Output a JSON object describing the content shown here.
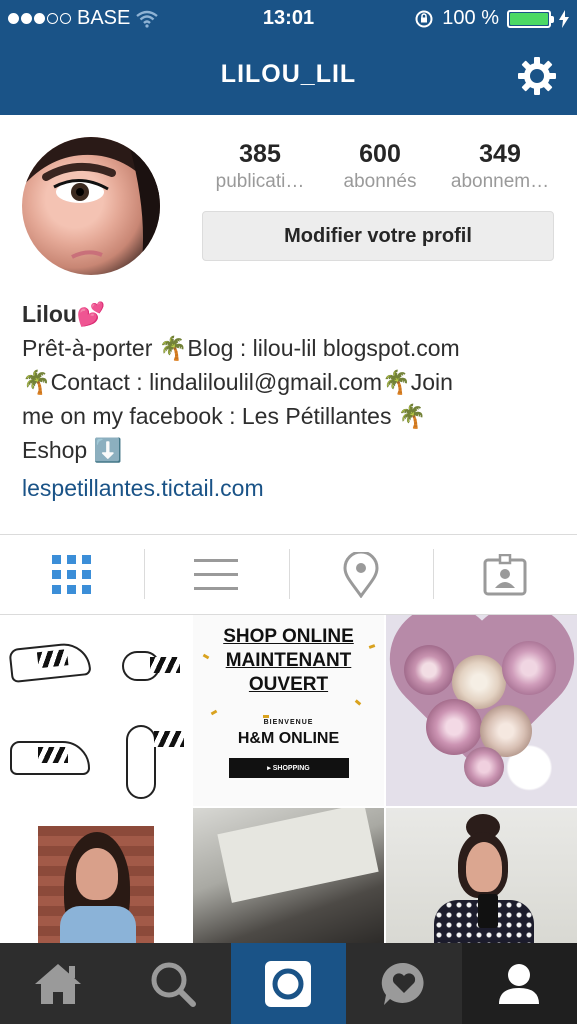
{
  "status_bar": {
    "carrier": "BASE",
    "time": "13:01",
    "battery_percent": "100 %",
    "signal_bars_filled": 3,
    "signal_bars_total": 5
  },
  "header": {
    "username": "LILOU_LIL"
  },
  "profile": {
    "stats": [
      {
        "count": "385",
        "label": "publicati…"
      },
      {
        "count": "600",
        "label": "abonnés"
      },
      {
        "count": "349",
        "label": "abonnem…"
      }
    ],
    "edit_button": "Modifier votre profil",
    "display_name": "Lilou💕",
    "bio_lines": [
      "Prêt-à-porter 🌴Blog : lilou-lil blogspot.com",
      "🌴Contact : lindaliloulil@gmail.com🌴Join",
      "me on my facebook : Les Pétillantes 🌴",
      "Eshop ⬇️"
    ],
    "website": "lespetillantes.tictail.com"
  },
  "tabs": [
    "grid-view",
    "list-view",
    "photo-map",
    "tagged-photos"
  ],
  "posts": {
    "shop_title_lines": [
      "SHOP ONLINE",
      "MAINTENANT",
      "OUVERT"
    ],
    "shop_welcome": "BIENVENUE",
    "shop_brand": "H&M ONLINE",
    "shop_button": "▸ SHOPPING"
  },
  "bottom_nav": [
    "home",
    "explore",
    "camera",
    "activity",
    "profile"
  ],
  "colors": {
    "brand": "#1a5387",
    "link": "#1a5387",
    "battery": "#4cd964",
    "bottom_bar": "#2d2d2d"
  }
}
